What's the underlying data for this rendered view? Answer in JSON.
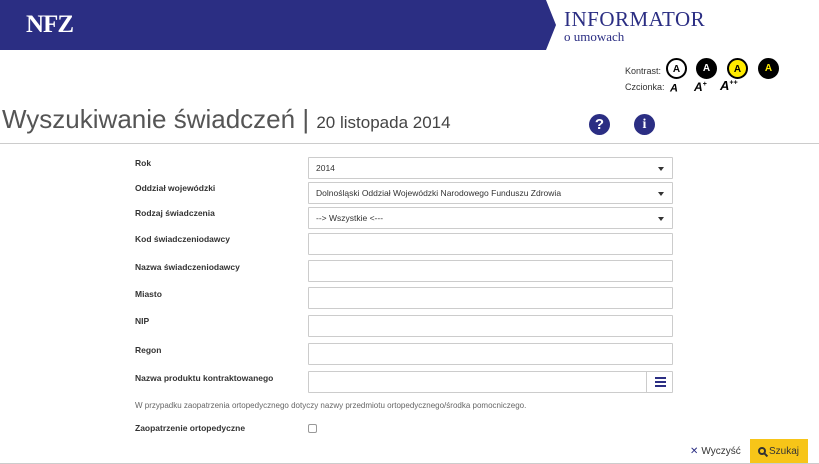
{
  "header": {
    "logo": "NFZ",
    "informator_title": "INFORMATOR",
    "informator_subtitle": "o umowach"
  },
  "accessibility": {
    "contrast_label": "Kontrast:",
    "font_label": "Czcionka:",
    "contrast_options": [
      "A",
      "A",
      "A",
      "A"
    ],
    "font_options": [
      {
        "base": "A",
        "sup": ""
      },
      {
        "base": "A",
        "sup": "+"
      },
      {
        "base": "A",
        "sup": "++"
      }
    ]
  },
  "page": {
    "title": "Wyszukiwanie świadczeń",
    "separator": "|",
    "date": "20 listopada 2014",
    "help_icon": "?",
    "info_icon": "i"
  },
  "form": {
    "rok_label": "Rok",
    "rok_value": "2014",
    "oddzial_label": "Oddział wojewódzki",
    "oddzial_value": "Dolnośląski Oddział Wojewódzki Narodowego Funduszu Zdrowia",
    "rodzaj_label": "Rodzaj świadczenia",
    "rodzaj_value": "--> Wszystkie <---",
    "kod_label": "Kod świadczeniodawcy",
    "kod_value": "",
    "nazwa_label": "Nazwa świadczeniodawcy",
    "nazwa_value": "",
    "miasto_label": "Miasto",
    "miasto_value": "",
    "nip_label": "NIP",
    "nip_value": "",
    "regon_label": "Regon",
    "regon_value": "",
    "produkt_label": "Nazwa produktu kontraktowanego",
    "produkt_value": "",
    "note": "W przypadku zaopatrzenia ortopedycznego dotyczy nazwy przedmiotu ortopedycznego/środka pomocniczego.",
    "ortho_label": "Zaopatrzenie ortopedyczne"
  },
  "actions": {
    "clear_icon": "✕",
    "clear_label": "Wyczyść",
    "search_label": "Szukaj"
  },
  "colors": {
    "brand": "#2b2e83",
    "search_button": "#f7c518"
  }
}
